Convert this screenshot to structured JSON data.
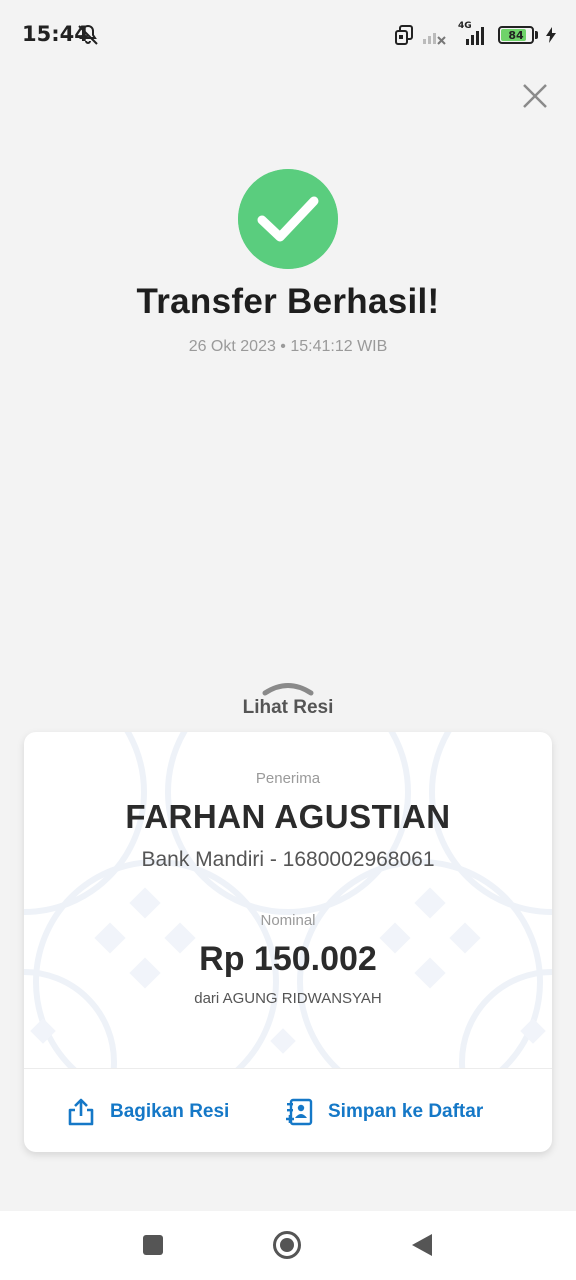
{
  "status_bar": {
    "time": "15:44",
    "network_label": "4G",
    "battery_level": "84",
    "battery_fraction": 0.84,
    "icons": [
      "mute-icon",
      "screen-cast-icon",
      "signal-icon",
      "signal-icon",
      "battery-icon",
      "charging-icon"
    ]
  },
  "header": {
    "close_icon": "close-icon"
  },
  "result": {
    "title": "Transfer Berhasil!",
    "datetime": "26 Okt 2023 • 15:41:12 WIB",
    "status_color": "#5acd7e"
  },
  "receipt_toggle": {
    "label": "Lihat Resi"
  },
  "receipt": {
    "recipient_label": "Penerima",
    "recipient_name": "FARHAN AGUSTIAN",
    "bank_info": "Bank Mandiri - 1680002968061",
    "amount_label": "Nominal",
    "amount": "Rp 150.002",
    "sender": "dari AGUNG RIDWANSYAH"
  },
  "actions": {
    "share_label": "Bagikan Resi",
    "save_label": "Simpan ke Daftar",
    "accent_color": "#1578c7"
  },
  "nav": {
    "icons": [
      "recents-icon",
      "home-icon",
      "back-icon"
    ]
  }
}
